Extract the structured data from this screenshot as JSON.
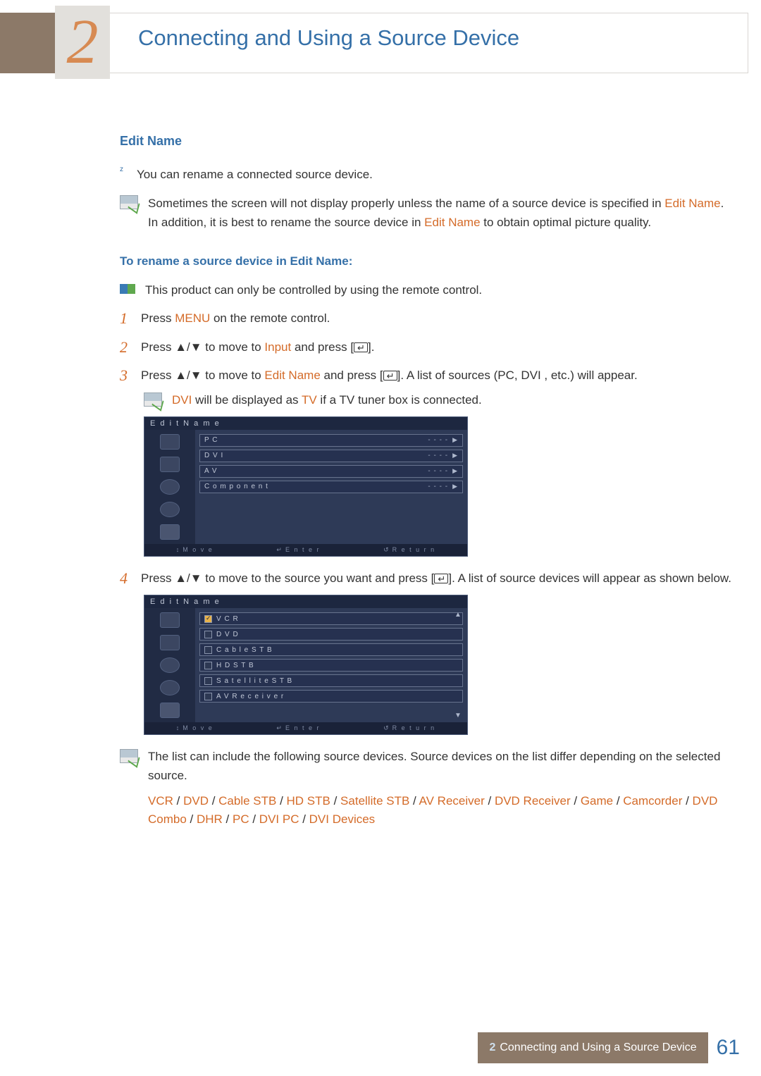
{
  "chapter": {
    "number": "2",
    "title": "Connecting and Using a Source Device"
  },
  "section": {
    "title": "Edit Name"
  },
  "intro_bullet": "You can rename a connected source device.",
  "note1": {
    "pre": "Sometimes the screen will not display properly unless the name of a source device is specified in ",
    "a": "Edit Name",
    "mid": ". In addition, it is best to rename the source device in ",
    "b": "Edit Name",
    "post": " to obtain optimal picture quality."
  },
  "how_to_heading": "To rename a source device in Edit Name:",
  "remote_note": "This product can only be controlled by using the remote control.",
  "step1": {
    "pre": "Press ",
    "a": "MENU",
    "post": " on the remote control."
  },
  "step2": {
    "pre": "Press ",
    "mid": " to move to ",
    "a": "Input",
    "post": " and press [",
    "close": "]."
  },
  "step3": {
    "pre": "Press ",
    "mid": " to move to ",
    "a": "Edit Name",
    "post": " and press [",
    "close": "]. A list of sources (PC, DVI , etc.) will appear."
  },
  "step3_note": {
    "a": "DVI",
    "mid": " will be displayed as ",
    "b": "TV",
    "post": " if a TV tuner box is connected."
  },
  "osd1": {
    "title": "E d i t   N a m e",
    "rows": [
      {
        "label": "P C",
        "value": "- - - -",
        "arrow": true
      },
      {
        "label": "D V I",
        "value": "- - - -",
        "arrow": true
      },
      {
        "label": "A V",
        "value": "- - - -",
        "arrow": true
      },
      {
        "label": "C o m p o n e n t",
        "value": "- - - -",
        "arrow": true
      }
    ],
    "footer": {
      "move": "M o v e",
      "enter": "E n t e r",
      "return": "R e t u r n"
    }
  },
  "step4": {
    "pre": "Press ",
    "mid": " to move to the source you want and press [",
    "post": "]. A list of source devices will appear as shown below."
  },
  "osd2": {
    "title": "E d i t   N a m e",
    "items": [
      {
        "label": "V C R",
        "checked": true
      },
      {
        "label": "D V D",
        "checked": false
      },
      {
        "label": "C a b l e   S T B",
        "checked": false
      },
      {
        "label": "H D   S T B",
        "checked": false
      },
      {
        "label": "S a t e l l i t e   S T B",
        "checked": false
      },
      {
        "label": "A V   R e c e i v e r",
        "checked": false
      }
    ],
    "footer": {
      "move": "M o v e",
      "enter": "E n t e r",
      "return": "R e t u r n"
    }
  },
  "list_note": "The list can include the following source devices. Source devices on the list differ depending on the selected source.",
  "devices_sep": " / ",
  "devices": [
    "VCR",
    "DVD",
    "Cable STB",
    "HD STB",
    "Satellite STB",
    "AV Receiver",
    "DVD Receiver",
    "Game",
    "Camcorder",
    "DVD Combo",
    "DHR",
    "PC",
    "DVI PC",
    "DVI Devices"
  ],
  "footer": {
    "chapter": "2",
    "title": "Connecting and Using a Source Device",
    "page": "61"
  }
}
